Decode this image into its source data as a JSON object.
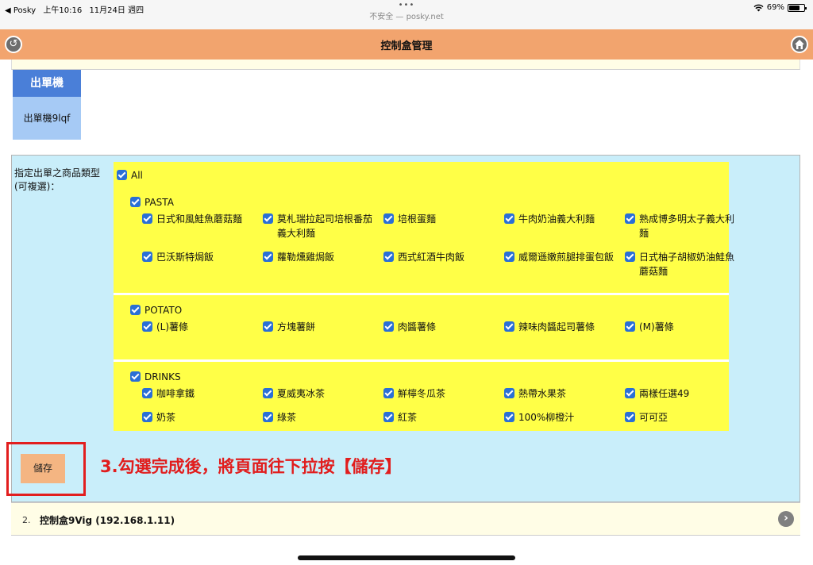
{
  "status_bar": {
    "back_app": "◀ Posky",
    "time": "上午10:16",
    "date": "11月24日 週四",
    "url": "不安全 — posky.net",
    "battery": "69%"
  },
  "header": {
    "title": "控制盒管理"
  },
  "printer": {
    "section_label": "出單機",
    "device_name": "出單機9lqf"
  },
  "panel": {
    "label": "指定出單之商品類型(可複選)：",
    "all_label": "All",
    "groups": [
      {
        "name": "PASTA",
        "items": [
          "日式和風鮭魚蘑菇麵",
          "莫札瑞拉起司培根番茄義大利麵",
          "培根蛋麵",
          "牛肉奶油義大利麵",
          "熟成博多明太子義大利麵",
          "巴沃斯特焗飯",
          "蘿勒燻雞焗飯",
          "西式紅酒牛肉飯",
          "威爾遜嫩煎腿排蛋包飯",
          "日式柚子胡椒奶油鮭魚蘑菇麵"
        ]
      },
      {
        "name": "POTATO",
        "items": [
          "(L)薯條",
          "方塊薯餅",
          "肉醬薯條",
          "辣味肉醬起司薯條",
          "(M)薯條"
        ]
      },
      {
        "name": "DRINKS",
        "items": [
          "咖啡拿鐵",
          "夏威夷冰茶",
          "鮮檸冬瓜茶",
          "熱帶水果茶",
          "兩樣任選49",
          "奶茶",
          "綠茶",
          "紅茶",
          "100%柳橙汁",
          "可可亞"
        ]
      }
    ]
  },
  "save_button": "儲存",
  "instruction": "3.勾選完成後，將頁面往下拉按【儲存】",
  "controller2": {
    "index": "2.",
    "name": "控制盒9Vig (192.168.1.11)"
  },
  "colors": {
    "header": "#f2a46e",
    "panel": "#c9eefa",
    "options": "#ffff47",
    "checkbox": "#2a6fd6",
    "annotation": "#e21e1e"
  }
}
